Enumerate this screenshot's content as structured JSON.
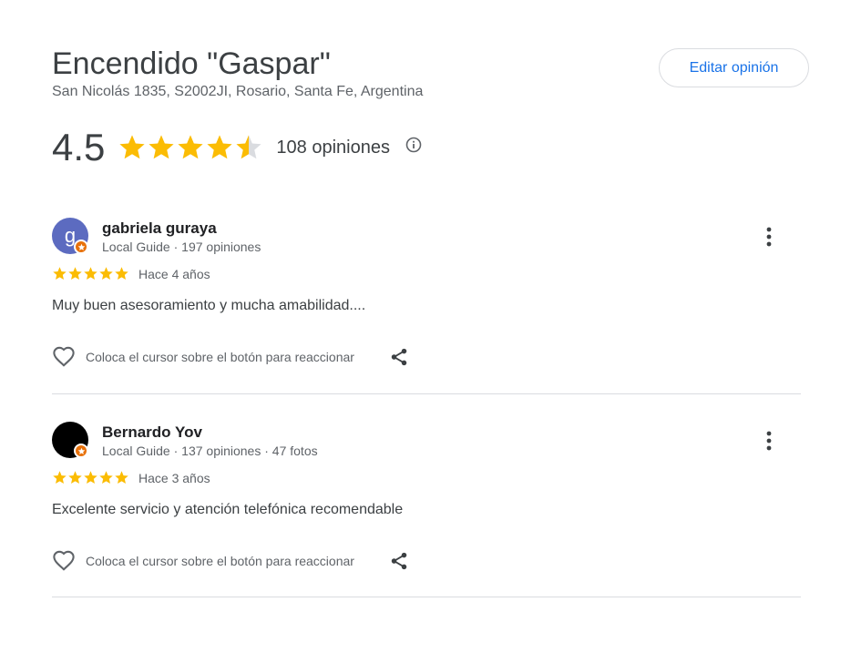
{
  "place": {
    "title": "Encendido \"Gaspar\"",
    "address": "San Nicolás 1835, S2002JI, Rosario, Santa Fe, Argentina"
  },
  "edit_button": {
    "label": "Editar opinión"
  },
  "summary": {
    "rating": "4.5",
    "rating_value": 4.5,
    "rating_max": 5,
    "review_count": "108 opiniones",
    "info_icon": "info-icon"
  },
  "colors": {
    "star": "#fbbc04",
    "star_empty": "#dadce0",
    "accent_blue": "#1a73e8",
    "local_guide_badge": "#e8710a"
  },
  "reviews": [
    {
      "avatar_letter": "g",
      "avatar_color": "#5c6bc0",
      "name": "gabriela guraya",
      "meta": "Local Guide · 197 opiniones",
      "stars": 5,
      "date": "Hace 4 años",
      "text": "Muy buen asesoramiento y mucha amabilidad....",
      "react_hint": "Coloca el cursor sobre el botón para reaccionar"
    },
    {
      "avatar_letter": "",
      "avatar_color": "#000000",
      "name": "Bernardo Yov",
      "meta": "Local Guide · 137 opiniones · 47 fotos",
      "stars": 5,
      "date": "Hace 3 años",
      "text": "Excelente servicio y atención telefónica recomendable",
      "react_hint": "Coloca el cursor sobre el botón para reaccionar"
    }
  ]
}
